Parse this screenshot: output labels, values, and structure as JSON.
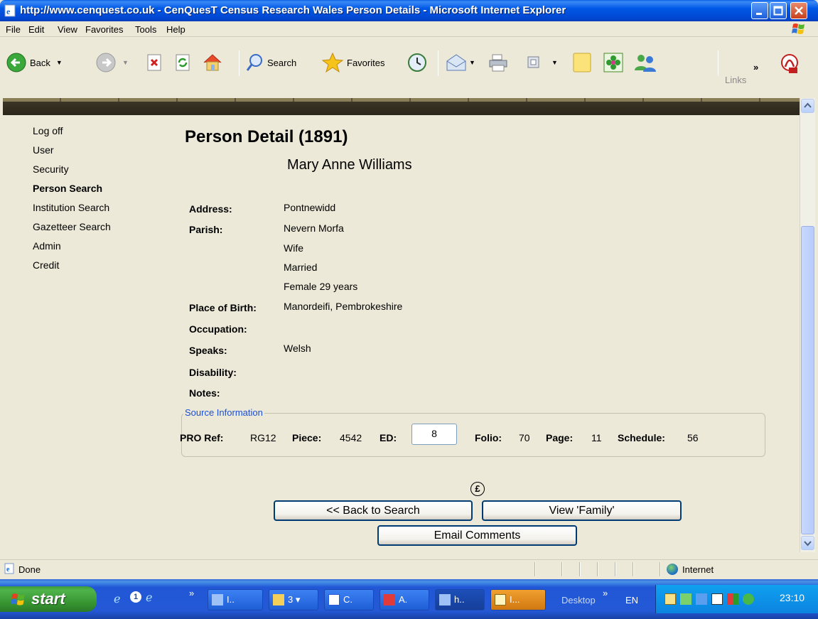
{
  "window": {
    "title": "http://www.cenquest.co.uk - CenQuesT Census Research Wales Person Details - Microsoft Internet Explorer"
  },
  "menu": [
    "File",
    "Edit",
    "View",
    "Favorites",
    "Tools",
    "Help"
  ],
  "toolbar": {
    "back_label": "Back",
    "search_label": "Search",
    "favorites_label": "Favorites",
    "links_label": "Links"
  },
  "nav": {
    "items": [
      {
        "label": "Log off"
      },
      {
        "label": "User"
      },
      {
        "label": "Security"
      },
      {
        "label": "Person Search",
        "active": true
      },
      {
        "label": "Institution Search"
      },
      {
        "label": "Gazetteer Search"
      },
      {
        "label": "Admin"
      },
      {
        "label": "Credit"
      }
    ]
  },
  "page": {
    "heading": "Person Detail (1891)",
    "person_name": "Mary Anne Williams",
    "fields": {
      "address_label": "Address:",
      "address": "Pontnewidd",
      "parish_label": "Parish:",
      "parish": "Nevern Morfa",
      "relation": "Wife",
      "marital": "Married",
      "sex_age": "Female 29 years",
      "birth_label": "Place of Birth:",
      "birth": "Manordeifi, Pembrokeshire",
      "occupation_label": "Occupation:",
      "speaks_label": "Speaks:",
      "speaks": "Welsh",
      "disability_label": "Disability:",
      "notes_label": "Notes:"
    },
    "source": {
      "legend": "Source Information",
      "pro_ref_label": "PRO Ref:",
      "pro_ref": "RG12",
      "piece_label": "Piece:",
      "piece": "4542",
      "ed_label": "ED:",
      "ed": "8",
      "folio_label": "Folio:",
      "folio": "70",
      "page_label": "Page:",
      "page": "11",
      "schedule_label": "Schedule:",
      "schedule": "56"
    },
    "pound_symbol": "£",
    "buttons": {
      "back": "<< Back to Search",
      "family": "View 'Family'",
      "email": "Email Comments"
    }
  },
  "statusbar": {
    "text": "Done",
    "zone": "Internet"
  },
  "taskbar": {
    "start": "start",
    "tasks": [
      "I..",
      "3",
      "C.",
      "A.",
      "h..",
      "I..."
    ],
    "desktop": "Desktop",
    "language": "EN",
    "clock": "23:10"
  }
}
